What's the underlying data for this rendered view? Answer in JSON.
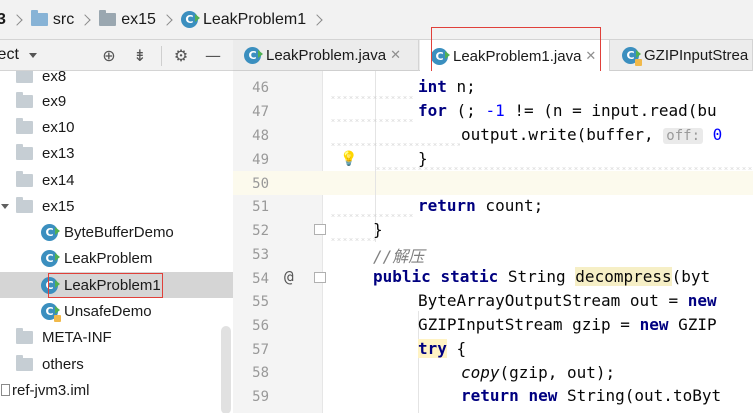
{
  "breadcrumb": {
    "items": [
      {
        "label": "3",
        "icon": "none"
      },
      {
        "label": "src",
        "icon": "folder-icon"
      },
      {
        "label": "ex15",
        "icon": "package-icon"
      },
      {
        "label": "LeakProblem1",
        "icon": "class-icon"
      }
    ]
  },
  "project_panel": {
    "title": "ject",
    "icons": [
      "locate-icon",
      "collapse-all-icon",
      "settings-icon",
      "hide-icon"
    ],
    "tree": [
      {
        "label": "ex8",
        "type": "folder"
      },
      {
        "label": "ex9",
        "type": "folder"
      },
      {
        "label": "ex10",
        "type": "folder"
      },
      {
        "label": "ex13",
        "type": "folder"
      },
      {
        "label": "ex14",
        "type": "folder"
      },
      {
        "label": "ex15",
        "type": "folder",
        "expanded": true
      },
      {
        "label": "ByteBufferDemo",
        "type": "class"
      },
      {
        "label": "LeakProblem",
        "type": "class"
      },
      {
        "label": "LeakProblem1",
        "type": "class",
        "selected": true
      },
      {
        "label": "UnsafeDemo",
        "type": "class"
      },
      {
        "label": "META-INF",
        "type": "folder"
      },
      {
        "label": "others",
        "type": "folder"
      },
      {
        "label": "ref-jvm3.iml",
        "type": "file"
      }
    ]
  },
  "tabs": [
    {
      "label": "LeakProblem.java",
      "active": false
    },
    {
      "label": "LeakProblem1.java",
      "active": true
    },
    {
      "label": "GZIPInputStrea",
      "active": false
    }
  ],
  "editor": {
    "line_numbers": [
      "46",
      "47",
      "48",
      "49",
      "50",
      "51",
      "52",
      "53",
      "54",
      "55",
      "56",
      "57",
      "58",
      "59"
    ],
    "code": {
      "l46_kw": "int",
      "l46_rest": " n;",
      "l47_kw": "for",
      "l47_a": " (; ",
      "l47_num": "-1",
      "l47_b": " != (n = input.read(bu",
      "l48_a": "output.write(buffer, ",
      "l48_hint": "off:",
      "l48_num": " 0",
      "l49": "}",
      "l51_kw": "return",
      "l51_rest": " count;",
      "l52": "}",
      "l53": "//解压",
      "l54_kw1": "public",
      "l54_kw2": "static",
      "l54_a": " String ",
      "l54_method": "decompress",
      "l54_b": "(byt",
      "l55_a": "ByteArrayOutputStream out = ",
      "l55_kw": "new",
      "l56_a": "GZIPInputStream gzip = ",
      "l56_kw": "new",
      "l56_b": " GZIP",
      "l57_kw": "try",
      "l57_rest": " {",
      "l58_it": "copy",
      "l58_rest": "(gzip, out);",
      "l59_kw1": "return",
      "l59_kw2": "new",
      "l59_rest": " String(out.toByt"
    },
    "gutter_marker": "@"
  }
}
